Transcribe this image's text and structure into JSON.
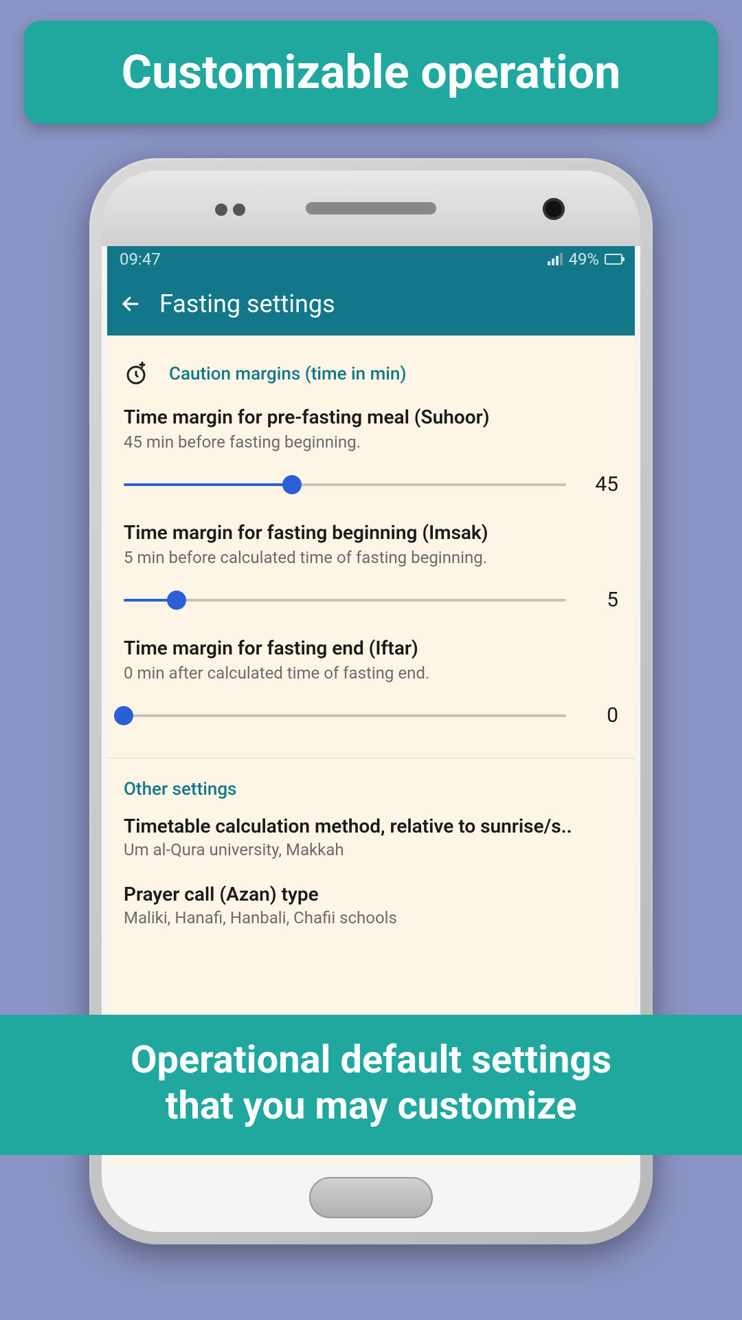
{
  "banners": {
    "top": "Customizable operation",
    "bottom_line1": "Operational default settings",
    "bottom_line2": "that you may customize"
  },
  "statusbar": {
    "time": "09:47",
    "battery_pct": "49%"
  },
  "appbar": {
    "title": "Fasting settings"
  },
  "sections": {
    "caution": {
      "header": "Caution margins (time in min)",
      "items": [
        {
          "title": "Time margin for pre-fasting meal (Suhoor)",
          "subtitle": "45 min before fasting beginning.",
          "value": "45",
          "pct": 38
        },
        {
          "title": "Time margin for fasting beginning (Imsak)",
          "subtitle": "5 min before calculated time of fasting beginning.",
          "value": "5",
          "pct": 12
        },
        {
          "title": "Time margin for fasting end (Iftar)",
          "subtitle": "0 min after calculated time of fasting end.",
          "value": "0",
          "pct": 0
        }
      ]
    },
    "other": {
      "header": "Other settings",
      "items": [
        {
          "title": "Timetable calculation method, relative to sunrise/s..",
          "subtitle": "Um al-Qura university, Makkah"
        },
        {
          "title": "Prayer call (Azan) type",
          "subtitle": "Maliki, Hanafi, Hanbali, Chafii schools"
        }
      ]
    }
  }
}
